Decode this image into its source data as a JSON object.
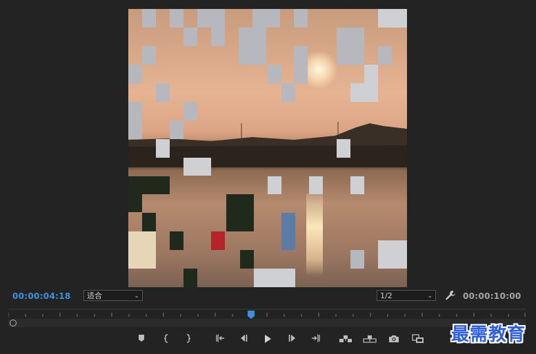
{
  "monitor": {
    "current_timecode": "00:00:04:18",
    "duration_timecode": "00:00:10:00",
    "zoom_select": {
      "value": "适合"
    },
    "resolution_select": {
      "value": "1/2"
    }
  },
  "timeline": {
    "playhead_position_fraction": 0.47
  },
  "transport": {
    "buttons": [
      "add-marker-icon",
      "mark-in-icon",
      "mark-out-icon",
      "go-to-in-icon",
      "step-back-icon",
      "play-icon",
      "step-forward-icon",
      "go-to-out-icon",
      "insert-icon",
      "overwrite-icon",
      "export-frame-icon",
      "compare-view-icon"
    ]
  },
  "watermark": {
    "text": "最需教育"
  },
  "colors": {
    "timecode_accent": "#3c93e0",
    "background": "#232323",
    "watermark": "#2f5fd8"
  }
}
